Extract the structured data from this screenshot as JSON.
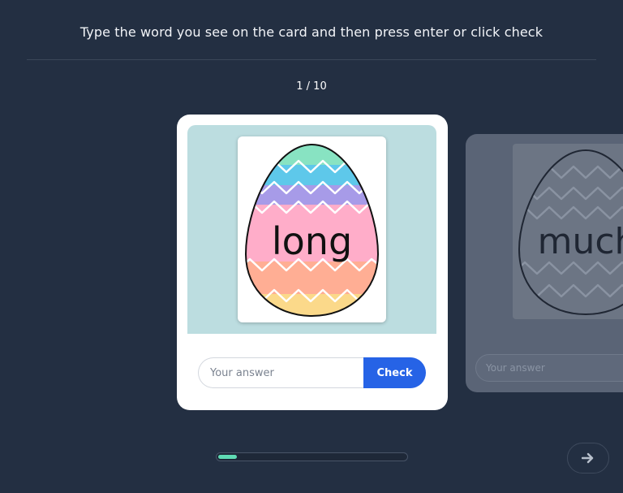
{
  "header": {
    "instruction": "Type the word you see on the card and then press enter or click check"
  },
  "counter": "1 / 10",
  "current_card": {
    "word": "long",
    "answer_placeholder": "Your answer",
    "check_label": "Check"
  },
  "next_card": {
    "word": "much",
    "answer_placeholder": "Your answer"
  },
  "progress": {
    "fraction": 0.1
  },
  "colors": {
    "background": "#232f42",
    "accent": "#2663e6",
    "progress": "#5fdbb4",
    "card_image_bg": "#bcdde0"
  },
  "icons": {
    "next": "arrow-right-icon"
  }
}
